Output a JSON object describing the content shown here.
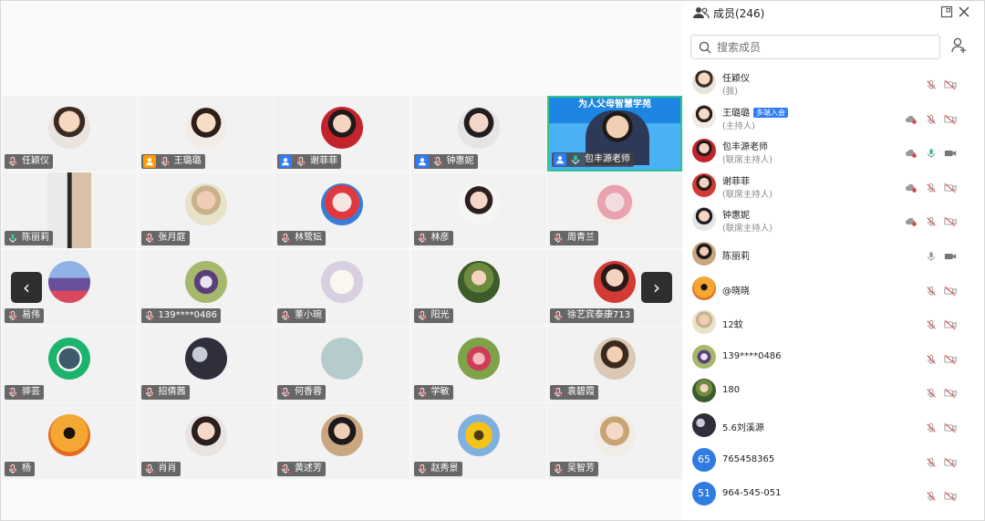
{
  "grid": {
    "tiles": [
      {
        "name": "任颖仪",
        "avatar": "g1",
        "mic": "muted",
        "host": null
      },
      {
        "name": "王璐璐",
        "avatar": "g2",
        "mic": "muted",
        "host": "orange"
      },
      {
        "name": "谢菲菲",
        "avatar": "g3",
        "mic": "muted",
        "host": "blue"
      },
      {
        "name": "钟惠妮",
        "avatar": "g4",
        "mic": "muted",
        "host": "blue"
      },
      {
        "name": "包丰源老师",
        "avatar": "speaker",
        "mic": "on",
        "host": "blue",
        "banner": "为人父母智慧学苑"
      },
      {
        "name": "陈丽莉",
        "avatar": "rect",
        "mic": "on",
        "host": null
      },
      {
        "name": "张月庭",
        "avatar": "g5",
        "mic": "muted",
        "host": null
      },
      {
        "name": "林鹭妘",
        "avatar": "g6",
        "mic": "muted",
        "host": null
      },
      {
        "name": "林彦",
        "avatar": "g7",
        "mic": "muted",
        "host": null
      },
      {
        "name": "周青兰",
        "avatar": "g8",
        "mic": "muted",
        "host": null
      },
      {
        "name": "易伟",
        "avatar": "g9",
        "mic": "muted",
        "host": null
      },
      {
        "name": "139****0486",
        "avatar": "g10",
        "mic": "muted",
        "host": null
      },
      {
        "name": "董小琬",
        "avatar": "g11",
        "mic": "muted",
        "host": null
      },
      {
        "name": "阳光",
        "avatar": "g12",
        "mic": "muted",
        "host": null
      },
      {
        "name": "徐艺宾泰康713",
        "avatar": "g13",
        "mic": "muted",
        "host": null
      },
      {
        "name": "骅芸",
        "avatar": "g14",
        "mic": "muted",
        "host": null
      },
      {
        "name": "招倩茜",
        "avatar": "g15",
        "mic": "muted",
        "host": null
      },
      {
        "name": "何香蓉",
        "avatar": "g16",
        "mic": "muted",
        "host": null
      },
      {
        "name": "学敏",
        "avatar": "g17",
        "mic": "muted",
        "host": null
      },
      {
        "name": "袁碧霞",
        "avatar": "g18",
        "mic": "muted",
        "host": null
      },
      {
        "name": "杨",
        "avatar": "g19",
        "mic": "muted",
        "host": null
      },
      {
        "name": "肖肖",
        "avatar": "g20",
        "mic": "muted",
        "host": null
      },
      {
        "name": "黄述芳",
        "avatar": "g21",
        "mic": "muted",
        "host": null
      },
      {
        "name": "赵秀景",
        "avatar": "g22",
        "mic": "muted",
        "host": null
      },
      {
        "name": "吴智芳",
        "avatar": "g23",
        "mic": "muted",
        "host": null
      }
    ],
    "prev_label": "‹",
    "next_label": "›"
  },
  "panel": {
    "title": "成员(246)",
    "search_placeholder": "搜索成员",
    "members": [
      {
        "name": "任颖仪",
        "role": "(我)",
        "avatar": "g1",
        "tag": "",
        "cloud": false,
        "mic": "muted",
        "cam": "off"
      },
      {
        "name": "王璐璐",
        "role": "(主持人)",
        "avatar": "g2",
        "tag": "多端入会",
        "cloud": true,
        "mic": "muted",
        "cam": "off"
      },
      {
        "name": "包丰源老师",
        "role": "(联席主持人)",
        "avatar": "g3",
        "tag": "",
        "cloud": true,
        "mic": "on",
        "cam": "on"
      },
      {
        "name": "谢菲菲",
        "role": "(联席主持人)",
        "avatar": "g13",
        "tag": "",
        "cloud": true,
        "mic": "muted",
        "cam": "off"
      },
      {
        "name": "钟惠妮",
        "role": "(联席主持人)",
        "avatar": "g4",
        "tag": "",
        "cloud": true,
        "mic": "muted",
        "cam": "off"
      },
      {
        "name": "陈丽莉",
        "role": "",
        "avatar": "g21",
        "tag": "",
        "cloud": false,
        "mic": "idle",
        "cam": "on"
      },
      {
        "name": "@晓晓",
        "role": "",
        "avatar": "g19",
        "tag": "",
        "cloud": false,
        "mic": "muted",
        "cam": "off"
      },
      {
        "name": "12蚊",
        "role": "",
        "avatar": "g5",
        "tag": "",
        "cloud": false,
        "mic": "muted",
        "cam": "off"
      },
      {
        "name": "139****0486",
        "role": "",
        "avatar": "g10",
        "tag": "",
        "cloud": false,
        "mic": "muted",
        "cam": "off"
      },
      {
        "name": "180",
        "role": "",
        "avatar": "g12",
        "tag": "",
        "cloud": false,
        "mic": "muted",
        "cam": "off"
      },
      {
        "name": "5.6刘溪源",
        "role": "",
        "avatar": "g15",
        "tag": "",
        "cloud": false,
        "mic": "muted",
        "cam": "off"
      },
      {
        "name": "765458365",
        "role": "",
        "avatar": "num",
        "badge": "65",
        "tag": "",
        "cloud": false,
        "mic": "muted",
        "cam": "off"
      },
      {
        "name": "964-545-051",
        "role": "",
        "avatar": "num",
        "badge": "51",
        "tag": "",
        "cloud": false,
        "mic": "muted",
        "cam": "off"
      }
    ]
  },
  "colors": {
    "accent": "#2f7df6",
    "muted": "#e0575c",
    "speaker_border": "#2fc48f",
    "host_orange": "#ff9d00"
  }
}
